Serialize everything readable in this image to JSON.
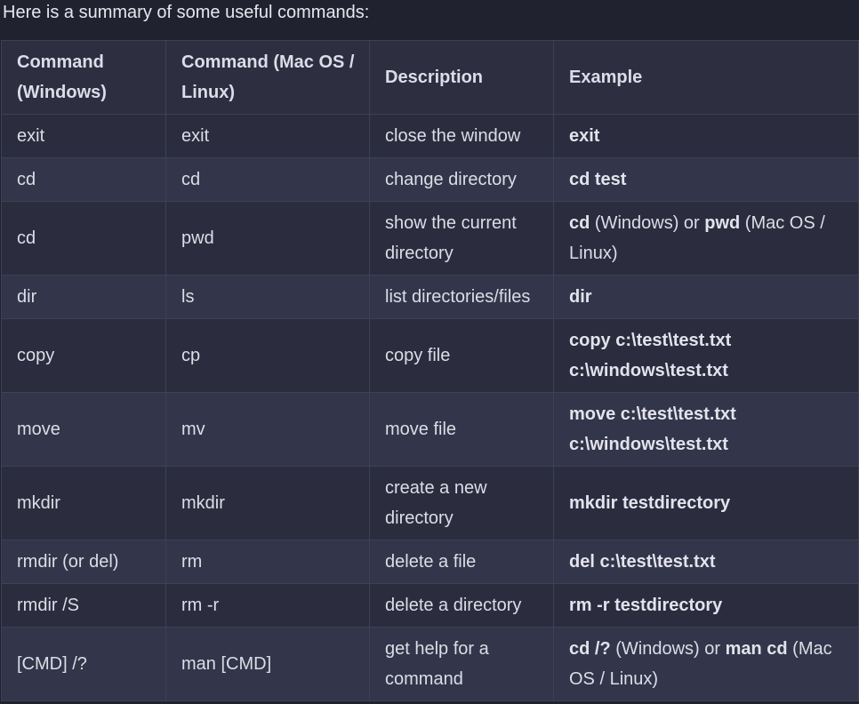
{
  "intro": "Here is a summary of some useful commands:",
  "table": {
    "headers": [
      "Command (Windows)",
      "Command (Mac OS / Linux)",
      "Description",
      "Example"
    ],
    "rows": [
      {
        "win": "exit",
        "unix": "exit",
        "desc": "close the window",
        "example": [
          {
            "t": "exit",
            "b": true
          }
        ]
      },
      {
        "win": "cd",
        "unix": "cd",
        "desc": "change directory",
        "example": [
          {
            "t": "cd test",
            "b": true
          }
        ]
      },
      {
        "win": "cd",
        "unix": "pwd",
        "desc": "show the current directory",
        "example": [
          {
            "t": "cd",
            "b": true
          },
          {
            "t": " (Windows) or ",
            "b": false
          },
          {
            "t": "pwd",
            "b": true
          },
          {
            "t": " (Mac OS / Linux)",
            "b": false
          }
        ]
      },
      {
        "win": "dir",
        "unix": "ls",
        "desc": "list directories/files",
        "example": [
          {
            "t": "dir",
            "b": true
          }
        ]
      },
      {
        "win": "copy",
        "unix": "cp",
        "desc": "copy file",
        "example": [
          {
            "t": "copy c:\\test\\test.txt c:\\windows\\test.txt",
            "b": true
          }
        ]
      },
      {
        "win": "move",
        "unix": "mv",
        "desc": "move file",
        "example": [
          {
            "t": "move c:\\test\\test.txt c:\\windows\\test.txt",
            "b": true
          }
        ]
      },
      {
        "win": "mkdir",
        "unix": "mkdir",
        "desc": "create a new directory",
        "example": [
          {
            "t": "mkdir testdirectory",
            "b": true
          }
        ]
      },
      {
        "win": "rmdir (or del)",
        "unix": "rm",
        "desc": "delete a file",
        "example": [
          {
            "t": "del c:\\test\\test.txt",
            "b": true
          }
        ]
      },
      {
        "win": "rmdir /S",
        "unix": "rm -r",
        "desc": "delete a directory",
        "example": [
          {
            "t": "rm -r testdirectory",
            "b": true
          }
        ]
      },
      {
        "win": "[CMD] /?",
        "unix": "man [CMD]",
        "desc": "get help for a command",
        "example": [
          {
            "t": "cd /?",
            "b": true
          },
          {
            "t": " (Windows) or ",
            "b": false
          },
          {
            "t": "man cd",
            "b": true
          },
          {
            "t": " (Mac OS / Linux)",
            "b": false
          }
        ]
      }
    ]
  }
}
